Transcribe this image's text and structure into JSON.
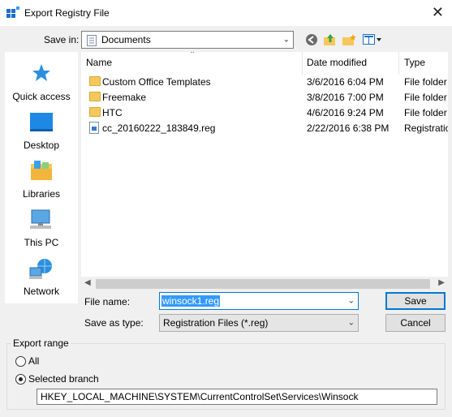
{
  "window": {
    "title": "Export Registry File",
    "close_glyph": "✕"
  },
  "toolbar": {
    "save_in_label": "Save in:",
    "location": "Documents",
    "icons": [
      "back-icon",
      "up-folder-icon",
      "new-folder-icon",
      "view-menu-icon"
    ]
  },
  "places": [
    {
      "label": "Quick access",
      "icon": "quick-access-icon"
    },
    {
      "label": "Desktop",
      "icon": "desktop-icon"
    },
    {
      "label": "Libraries",
      "icon": "libraries-icon"
    },
    {
      "label": "This PC",
      "icon": "this-pc-icon"
    },
    {
      "label": "Network",
      "icon": "network-icon"
    }
  ],
  "file_list": {
    "columns": [
      "Name",
      "Date modified",
      "Type"
    ],
    "rows": [
      {
        "name": "Custom Office Templates",
        "date": "3/6/2016 6:04 PM",
        "type": "File folder",
        "kind": "folder"
      },
      {
        "name": "Freemake",
        "date": "3/8/2016 7:00 PM",
        "type": "File folder",
        "kind": "folder"
      },
      {
        "name": "HTC",
        "date": "4/6/2016 9:24 PM",
        "type": "File folder",
        "kind": "folder"
      },
      {
        "name": "cc_20160222_183849.reg",
        "date": "2/22/2016 6:38 PM",
        "type": "Registration",
        "kind": "reg"
      }
    ]
  },
  "form": {
    "file_name_label": "File name:",
    "file_name_value": "winsock1.reg",
    "save_as_type_label": "Save as type:",
    "save_as_type_value": "Registration Files (*.reg)",
    "save_button": "Save",
    "cancel_button": "Cancel"
  },
  "export_range": {
    "title": "Export range",
    "all_label": "All",
    "selected_label": "Selected branch",
    "selected": "Selected branch",
    "branch_path": "HKEY_LOCAL_MACHINE\\SYSTEM\\CurrentControlSet\\Services\\Winsock"
  },
  "colors": {
    "accent": "#0078d7",
    "selection": "#3399ff",
    "folder": "#f6c75a"
  }
}
